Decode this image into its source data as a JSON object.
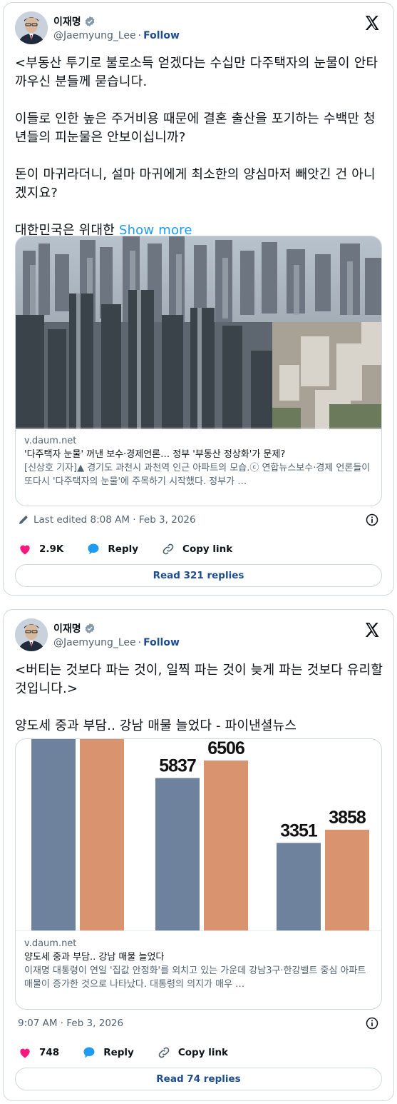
{
  "tweets": [
    {
      "author": {
        "name": "이재명",
        "handle": "@Jaemyung_Lee",
        "separator": "·",
        "follow_label": "Follow"
      },
      "text": "<부동산 투기로 불로소득 얻겠다는 수십만 다주택자의 눈물이 안타까우신 분들께 묻습니다.\n\n이들로 인한 높은 주거비용 때문에 결혼 출산을 포기하는 수백만 청년들의 피눈물은 안보이십니까?\n\n돈이 마귀라더니, 설마 마귀에게 최소한의 양심마저 빼앗긴 건 아니겠지요?\n\n대한민국은 위대한 ",
      "show_more": "Show more",
      "card": {
        "image": "aerial photo of dense apartment towers",
        "domain": "v.daum.net",
        "title": "'다주택자 눈물' 꺼낸 보수·경제언론… 정부 '부동산 정상화'가 문제?",
        "description": "[신상호 기자]▲ 경기도 과천시 과천역 인근 아파트의 모습.ⓒ 연합뉴스보수·경제 언론들이 또다시 '다주택자의 눈물'에 주목하기 시작했다. 정부가 …"
      },
      "timestamp": "Last edited 8:08 AM · Feb 3, 2026",
      "likes": "2.9K",
      "reply_label": "Reply",
      "copy_link_label": "Copy link",
      "read_replies": "Read 321 replies"
    },
    {
      "author": {
        "name": "이재명",
        "handle": "@Jaemyung_Lee",
        "separator": "·",
        "follow_label": "Follow"
      },
      "text": "<버티는 것보다 파는 것이, 일찍 파는 것이 늦게 파는 것보다 유리할 것입니다.>\n\n양도세 중과 부담.. 강남 매물 늘었다 - 파이낸셜뉴스",
      "card": {
        "domain": "v.daum.net",
        "title": "양도세 중과 부담.. 강남 매물 늘었다",
        "description": "이재명 대통령이 연일 '집값 안정화'를 외치고 있는 가운데 강남3구·한강벨트 중심 아파트 매물이 증가한 것으로 나타났다. 대통령의 의지가 매우 …"
      },
      "timestamp": "9:07 AM · Feb 3, 2026",
      "likes": "748",
      "reply_label": "Reply",
      "copy_link_label": "Copy link",
      "read_replies": "Read 74 replies"
    }
  ],
  "chart_data": {
    "type": "bar",
    "categories": [
      "",
      "",
      ""
    ],
    "series": [
      {
        "values": [
          null,
          5837,
          3351
        ]
      },
      {
        "values": [
          null,
          6506,
          3858
        ]
      }
    ],
    "colors": [
      "#6f829d",
      "#d9946f"
    ],
    "data_labels": [
      "",
      "",
      "5837",
      "6506",
      "3351",
      "3858"
    ],
    "note_first_group": "bars cropped at top, labels not visible"
  },
  "icons": {
    "verified": "verified-badge-icon",
    "x_logo": "x-logo-icon",
    "heart": "heart-icon",
    "reply": "reply-bubble-icon",
    "link": "link-icon",
    "info": "info-icon",
    "pencil": "pencil-icon"
  },
  "colors": {
    "like": "#f91880",
    "reply": "#1d9bf0",
    "link_text": "#1d4d8f",
    "muted": "#536471"
  }
}
